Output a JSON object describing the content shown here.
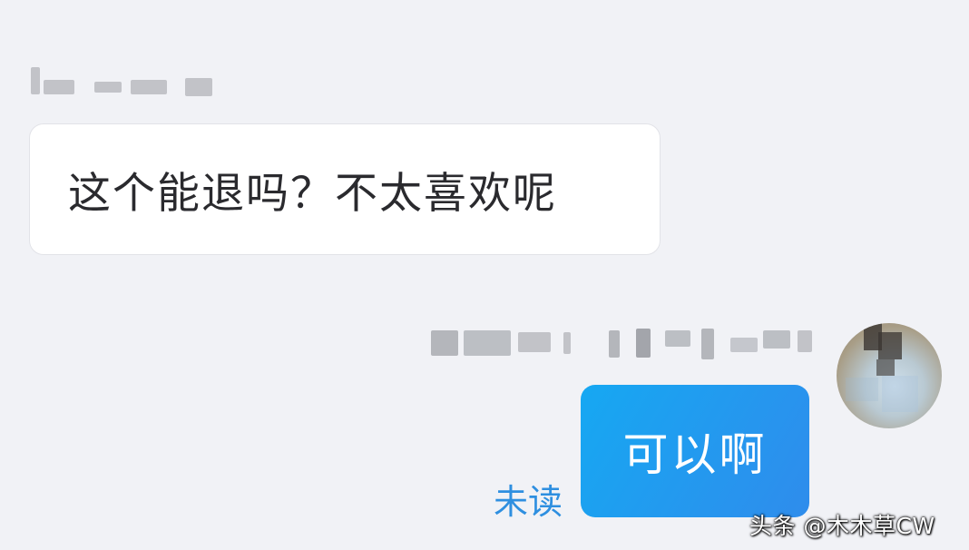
{
  "chat": {
    "incoming": {
      "text": "这个能退吗？不太喜欢呢"
    },
    "outgoing": {
      "text": "可以啊",
      "status": "未读"
    }
  },
  "watermark": "头条 @木木草CW",
  "icons": {
    "avatar": "user-avatar-blurred"
  }
}
